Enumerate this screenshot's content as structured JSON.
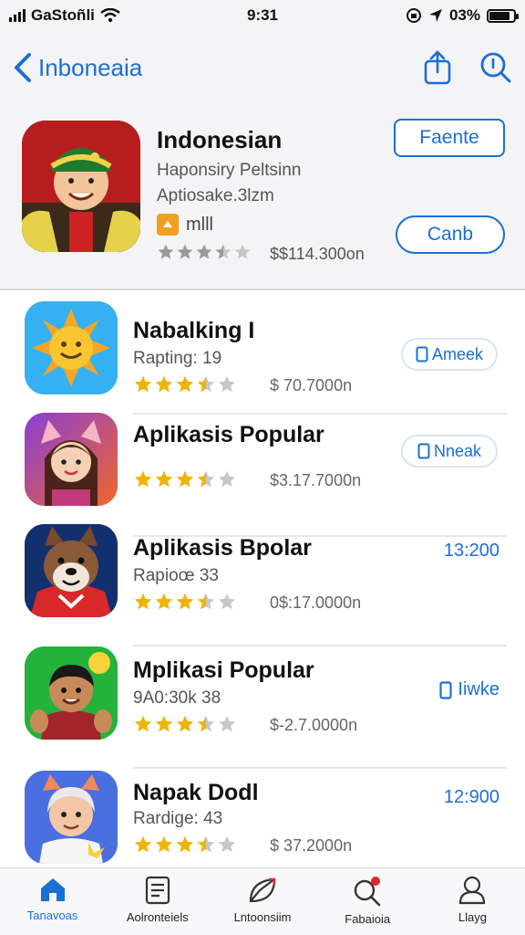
{
  "status_bar": {
    "carrier": "GaStoñli",
    "time": "9:31",
    "battery": "03%",
    "battery_level": 0.85
  },
  "nav": {
    "back_label": "Inboneaia",
    "share_icon": "share-icon",
    "search_icon": "search-icon"
  },
  "featured": {
    "title": "Indonesian",
    "subtitle": "Haponsiry Peltsinn",
    "subtitle2": "Aptiosake.3lzm",
    "badge_text": "mlll",
    "price": "$$114.300on",
    "rating": 3.5,
    "button_primary": "Faente",
    "button_secondary": "Canb"
  },
  "apps": [
    {
      "title": "Nabalking  I",
      "subtitle": "Rapting: 19",
      "rating": 3.5,
      "price": "$ 70.7000n",
      "action": "Ameek",
      "action_type": "pill"
    },
    {
      "title": "Aplikasis Popular",
      "subtitle": "",
      "rating": 3.5,
      "price": "$3.17.7000n",
      "action": "Nneak",
      "action_type": "pill"
    },
    {
      "title": "Aplikasis Bpolar",
      "subtitle": "Rapioœ 33",
      "rating": 3.5,
      "price": "0$:17.0000n",
      "action": "13:200",
      "action_type": "text"
    },
    {
      "title": "Mplikasi Popular",
      "subtitle": "9A0:30k 38",
      "rating": 3.5,
      "price": "$-2.7.0000n",
      "action": "Iiwke",
      "action_type": "text-icon"
    },
    {
      "title": "Napak Dodl",
      "subtitle": "Rardige: 43",
      "rating": 3.5,
      "price": "$ 37.2000n",
      "action": "12:900",
      "action_type": "text"
    }
  ],
  "tabs": [
    {
      "label": "Tanavoas",
      "icon": "home-icon",
      "active": true
    },
    {
      "label": "Aolronteiels",
      "icon": "document-icon",
      "active": false
    },
    {
      "label": "Lntoonsiim",
      "icon": "compass-icon",
      "active": false
    },
    {
      "label": "Fabaioia",
      "icon": "search-icon",
      "active": false
    },
    {
      "label": "Llayg",
      "icon": "profile-icon",
      "active": false
    }
  ],
  "colors": {
    "accent": "#1a6fd6",
    "star": "#f0b400",
    "star_empty": "#c7c7c7"
  }
}
